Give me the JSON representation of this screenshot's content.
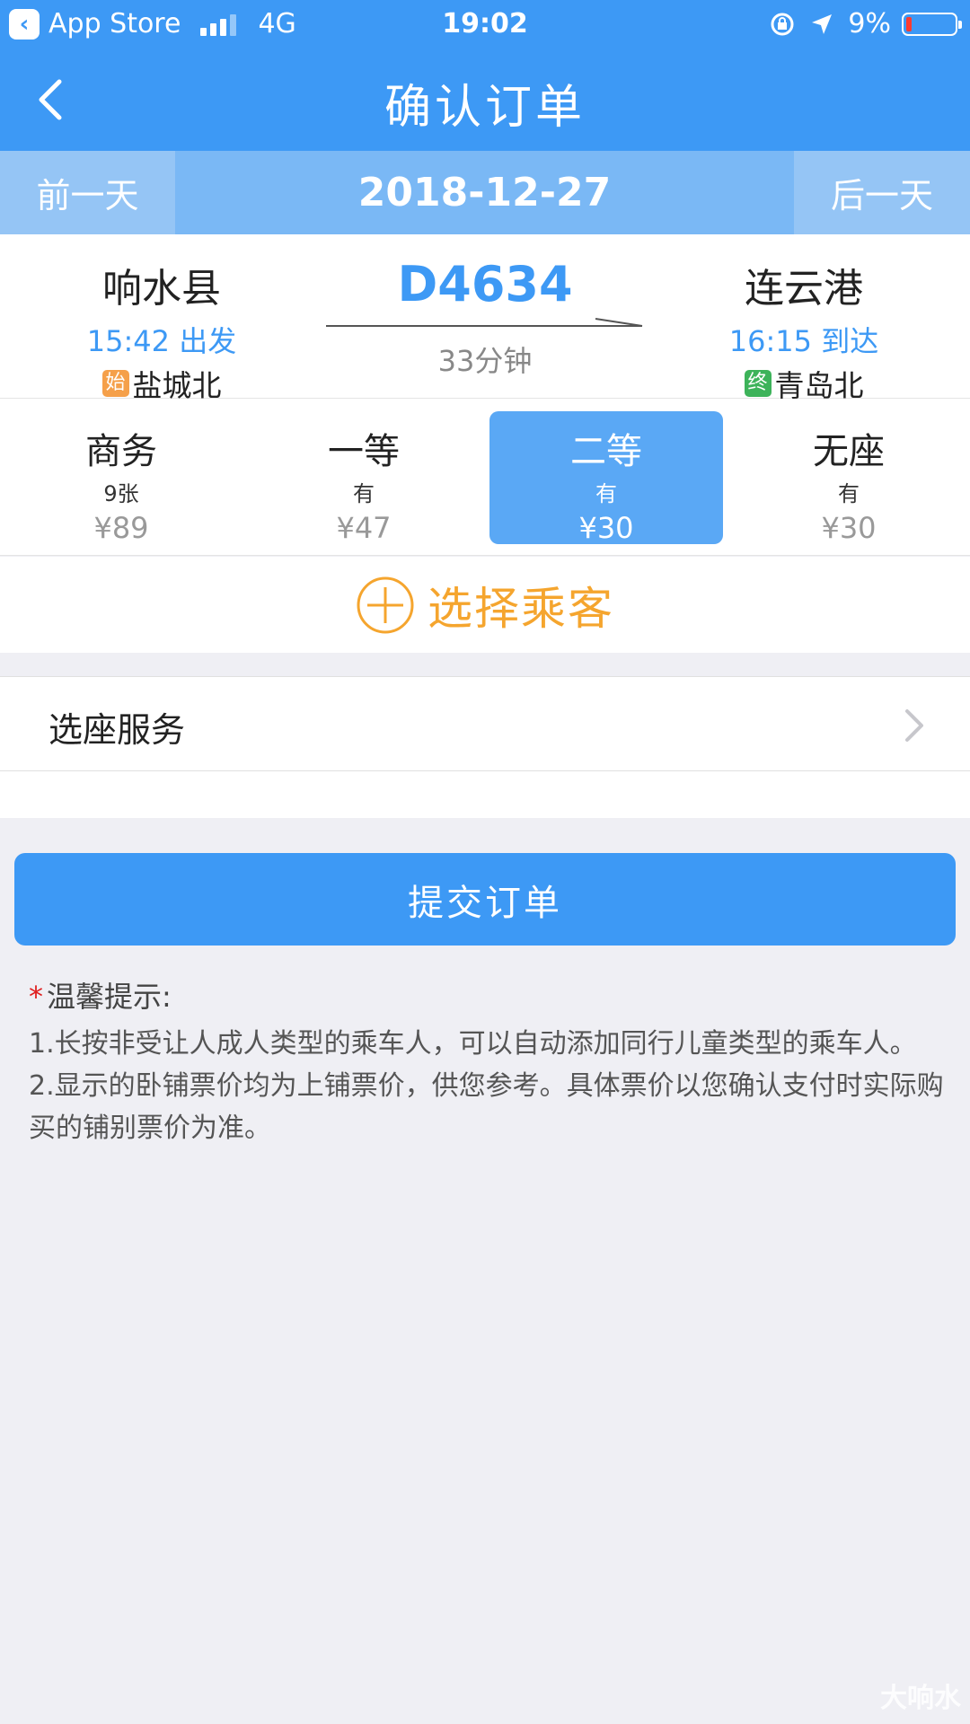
{
  "status_bar": {
    "back_app": "App Store",
    "network": "4G",
    "time": "19:02",
    "battery": "9%"
  },
  "navbar": {
    "title": "确认订单"
  },
  "date_bar": {
    "prev_label": "前一天",
    "date": "2018-12-27",
    "next_label": "后一天"
  },
  "train": {
    "number": "D4634",
    "duration": "33分钟",
    "departure": {
      "station": "响水县",
      "time": "15:42 出发",
      "badge": "始",
      "terminal": "盐城北"
    },
    "arrival": {
      "station": "连云港",
      "time": "16:15 到达",
      "badge": "终",
      "terminal": "青岛北"
    }
  },
  "seats": [
    {
      "name": "商务",
      "count": "9张",
      "price": "¥89",
      "selected": false
    },
    {
      "name": "一等",
      "count": "有",
      "price": "¥47",
      "selected": false
    },
    {
      "name": "二等",
      "count": "有",
      "price": "¥30",
      "selected": true
    },
    {
      "name": "无座",
      "count": "有",
      "price": "¥30",
      "selected": false
    }
  ],
  "passenger": {
    "label": "选择乘客"
  },
  "service": {
    "label": "选座服务"
  },
  "submit": {
    "label": "提交订单"
  },
  "tips": {
    "marker": "*",
    "title": "温馨提示:",
    "items": [
      "1.长按非受让人成人类型的乘车人，可以自动添加同行儿童类型的乘车人。",
      "2.显示的卧铺票价均为上铺票价，供您参考。具体票价以您确认支付时实际购买的铺别票价为准。"
    ]
  },
  "watermark": "大响水",
  "colors": {
    "primary": "#3d99f5",
    "date_bar": "#7ab8f5",
    "accent": "#f5a52e",
    "background": "#efeff4"
  }
}
